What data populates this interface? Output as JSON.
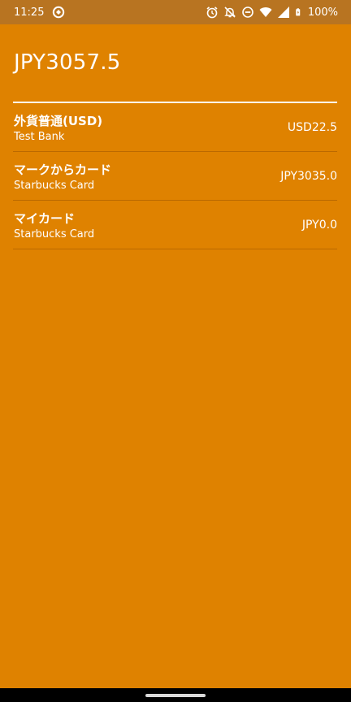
{
  "status_bar": {
    "time": "11:25",
    "battery": "100%",
    "icons": [
      "app-notification-icon",
      "alarm-icon",
      "notifications-off-icon",
      "do-not-disturb-icon",
      "wifi-icon",
      "signal-icon",
      "battery-icon"
    ]
  },
  "total": "JPY3057.5",
  "accounts": [
    {
      "name": "外貨普通(USD)",
      "bank": "Test Bank",
      "balance": "USD22.5"
    },
    {
      "name": "マークからカード",
      "bank": "Starbucks Card",
      "balance": "JPY3035.0"
    },
    {
      "name": "マイカード",
      "bank": "Starbucks Card",
      "balance": "JPY0.0"
    }
  ],
  "colors": {
    "background": "#DF8200",
    "status_bar": "#B87421",
    "text": "#FFFFFF"
  }
}
